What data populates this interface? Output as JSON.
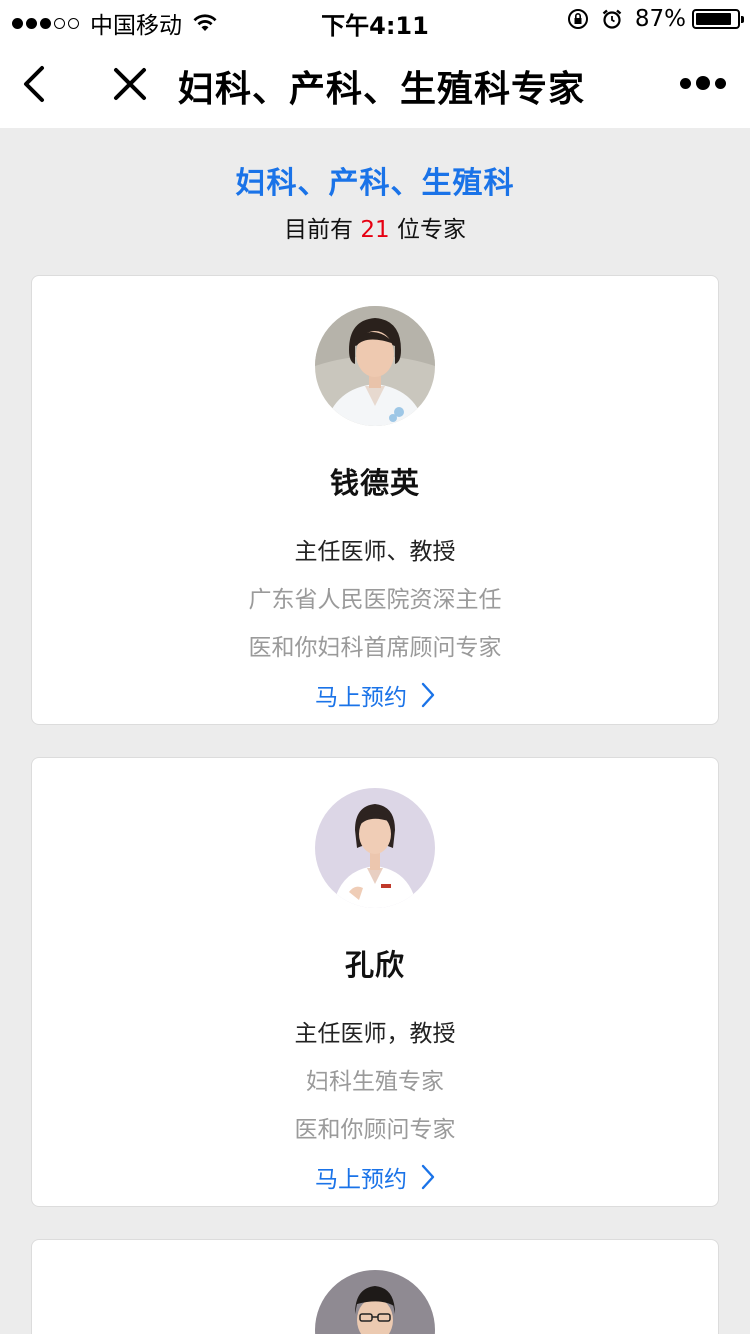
{
  "status_bar": {
    "carrier": "中国移动",
    "time": "下午4:11",
    "battery_percent": "87%",
    "battery_level": 0.87
  },
  "nav": {
    "title": "妇科、产科、生殖科专家",
    "back_icon": "chevron-left-icon",
    "close_icon": "close-icon",
    "more_icon": "more-dots-icon"
  },
  "header": {
    "department": "妇科、产科、生殖科",
    "count_prefix": "目前有",
    "count": "21",
    "count_suffix": "位专家"
  },
  "colors": {
    "accent_blue": "#1a73e8",
    "count_red": "#e60012",
    "background": "#ececec"
  },
  "doctors": [
    {
      "name": "钱德英",
      "title": "主任医师、教授",
      "lines": [
        "广东省人民医院资深主任",
        "医和你妇科首席顾问专家"
      ],
      "book_label": "马上预约"
    },
    {
      "name": "孔欣",
      "title": "主任医师，教授",
      "lines": [
        "妇科生殖专家",
        "医和你顾问专家"
      ],
      "book_label": "马上预约"
    }
  ]
}
